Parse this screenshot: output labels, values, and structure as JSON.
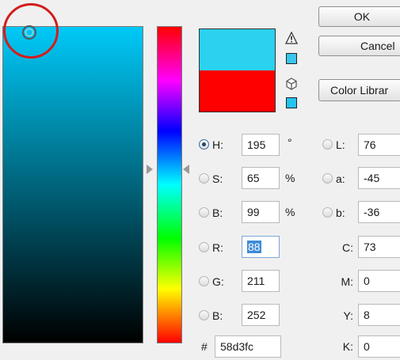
{
  "buttons": {
    "ok": "OK",
    "cancel": "Cancel",
    "color_libraries": "Color Librar"
  },
  "swatches": {
    "new_color": "#2ad2ef",
    "current_color": "#ff0000",
    "warning_square": "#38c6ee",
    "web_square": "#23c4f0"
  },
  "icons": {
    "gamut_warning": "warning-triangle-icon",
    "web_safe": "cube-icon",
    "picker": "circle-target-icon"
  },
  "hsb": {
    "h": {
      "label": "H:",
      "value": "195",
      "unit": "°"
    },
    "s": {
      "label": "S:",
      "value": "65",
      "unit": "%"
    },
    "b": {
      "label": "B:",
      "value": "99",
      "unit": "%"
    }
  },
  "rgb": {
    "r": {
      "label": "R:",
      "value": "88"
    },
    "g": {
      "label": "G:",
      "value": "211"
    },
    "b": {
      "label": "B:",
      "value": "252"
    }
  },
  "lab": {
    "l": {
      "label": "L:",
      "value": "76"
    },
    "a": {
      "label": "a:",
      "value": "-45"
    },
    "b": {
      "label": "b:",
      "value": "-36"
    }
  },
  "cmyk": {
    "c": {
      "label": "C:",
      "value": "73"
    },
    "m": {
      "label": "M:",
      "value": "0"
    },
    "y": {
      "label": "Y:",
      "value": "8"
    },
    "k": {
      "label": "K:",
      "value": "0"
    }
  },
  "hex": {
    "label": "#",
    "value": "58d3fc"
  },
  "colors": {
    "highlight_ring": "#d21d1d",
    "selection": "#3d8bd6"
  }
}
